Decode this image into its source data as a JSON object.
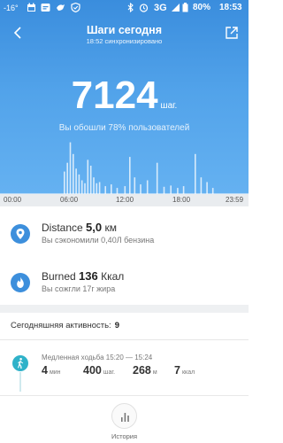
{
  "status_bar": {
    "temperature": "-16°",
    "signal_label": "3G",
    "battery": "80%",
    "time": "18:53"
  },
  "header": {
    "title": "Шаги сегодня",
    "sync_status": "18:52 синхронизировано"
  },
  "steps": {
    "count": "7124",
    "unit": "шаг.",
    "comparison": "Вы обошли 78% пользователей"
  },
  "chart_data": {
    "type": "bar",
    "x_tick_labels": [
      "00:00",
      "06:00",
      "12:00",
      "18:00",
      "23:59"
    ],
    "xlim": [
      0,
      24
    ],
    "bars": [
      {
        "x": 5.8,
        "v": 0.4
      },
      {
        "x": 6.1,
        "v": 0.55
      },
      {
        "x": 6.4,
        "v": 0.9
      },
      {
        "x": 6.7,
        "v": 0.7
      },
      {
        "x": 7.0,
        "v": 0.45
      },
      {
        "x": 7.3,
        "v": 0.35
      },
      {
        "x": 7.6,
        "v": 0.25
      },
      {
        "x": 7.9,
        "v": 0.2
      },
      {
        "x": 8.2,
        "v": 0.6
      },
      {
        "x": 8.5,
        "v": 0.5
      },
      {
        "x": 8.8,
        "v": 0.3
      },
      {
        "x": 9.1,
        "v": 0.2
      },
      {
        "x": 9.4,
        "v": 0.22
      },
      {
        "x": 10.0,
        "v": 0.15
      },
      {
        "x": 10.6,
        "v": 0.18
      },
      {
        "x": 11.2,
        "v": 0.12
      },
      {
        "x": 12.0,
        "v": 0.15
      },
      {
        "x": 12.5,
        "v": 0.65
      },
      {
        "x": 13.0,
        "v": 0.3
      },
      {
        "x": 13.6,
        "v": 0.18
      },
      {
        "x": 14.3,
        "v": 0.25
      },
      {
        "x": 15.3,
        "v": 0.55
      },
      {
        "x": 16.0,
        "v": 0.14
      },
      {
        "x": 16.7,
        "v": 0.16
      },
      {
        "x": 17.4,
        "v": 0.12
      },
      {
        "x": 18.0,
        "v": 0.15
      },
      {
        "x": 19.2,
        "v": 0.7
      },
      {
        "x": 19.8,
        "v": 0.3
      },
      {
        "x": 20.4,
        "v": 0.22
      },
      {
        "x": 21.0,
        "v": 0.12
      }
    ]
  },
  "distance": {
    "label": "Distance",
    "value": "5,0",
    "unit": "км",
    "subtitle": "Вы сэкономили 0,40Л бензина"
  },
  "burned": {
    "label": "Burned",
    "value": "136",
    "unit": "Ккал",
    "subtitle": "Вы сожгли 17г жира"
  },
  "activity": {
    "heading": "Сегодняшняя активность:",
    "count": "9",
    "items": [
      {
        "title": "Медленная ходьба 15:20 — 15:24",
        "duration": "4",
        "duration_unit": "мин",
        "steps": "400",
        "steps_unit": "шаг.",
        "distance": "268",
        "distance_unit": "м",
        "calories": "7",
        "calories_unit": "ккал"
      }
    ]
  },
  "bottom": {
    "history_label": "История"
  },
  "colors": {
    "accent_blue": "#3d8fdc",
    "walk_teal": "#2fb2c9"
  }
}
